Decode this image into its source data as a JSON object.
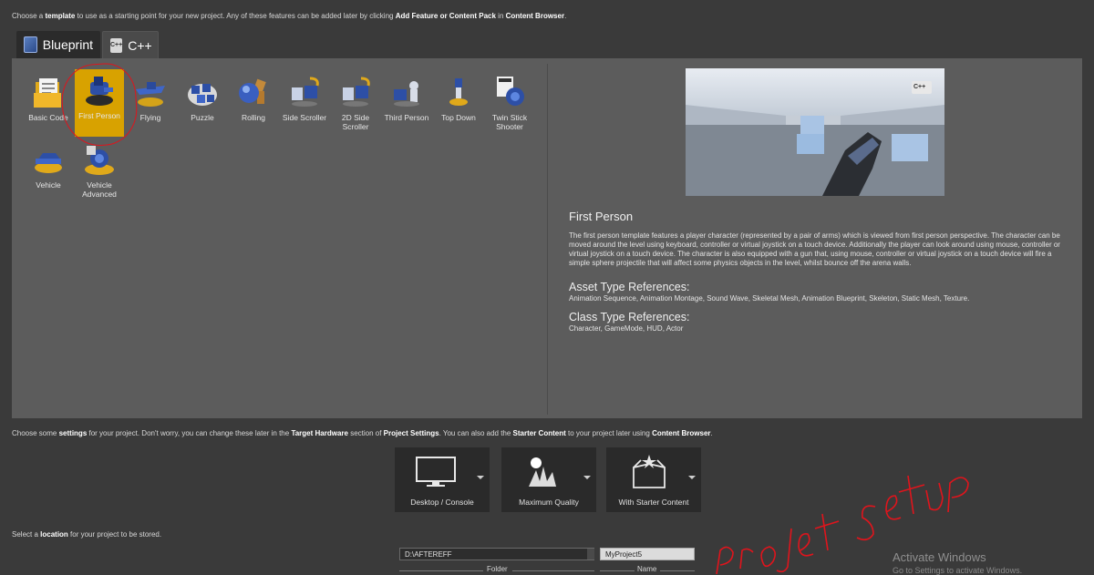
{
  "header": {
    "instr_parts": [
      "Choose a ",
      "template",
      " to use as a starting point for your new project.  Any of these features can be added later by clicking ",
      "Add Feature or Content Pack",
      " in ",
      "Content Browser",
      "."
    ]
  },
  "tabs": [
    {
      "label": "Blueprint",
      "icon": "blueprint-icon"
    },
    {
      "label": "C++",
      "icon": "cpp-icon",
      "icon_text": "C++"
    }
  ],
  "templates": [
    {
      "label": "Basic Code",
      "icon": "basic-code-icon"
    },
    {
      "label": "First Person",
      "icon": "first-person-icon",
      "selected": true
    },
    {
      "label": "Flying",
      "icon": "flying-icon"
    },
    {
      "label": "Puzzle",
      "icon": "puzzle-icon"
    },
    {
      "label": "Rolling",
      "icon": "rolling-icon"
    },
    {
      "label": "Side Scroller",
      "icon": "side-scroller-icon"
    },
    {
      "label": "2D Side Scroller",
      "icon": "2d-side-scroller-icon"
    },
    {
      "label": "Third Person",
      "icon": "third-person-icon"
    },
    {
      "label": "Top Down",
      "icon": "top-down-icon"
    },
    {
      "label": "Twin Stick Shooter",
      "icon": "twin-stick-shooter-icon"
    },
    {
      "label": "Vehicle",
      "icon": "vehicle-icon"
    },
    {
      "label": "Vehicle Advanced",
      "icon": "vehicle-advanced-icon"
    }
  ],
  "preview": {
    "badge": "C++",
    "title": "First Person",
    "description": "The first person template features a player character (represented by a pair of arms) which is viewed from first person perspective. The character can be moved around the level using keyboard, controller or virtual joystick on a touch device. Additionally the player can look around using mouse, controller or virtual joystick on a touch device. The character is also equipped with a gun that, using mouse, controller or virtual joystick on a touch device will fire a simple sphere projectile that will affect some physics objects in the level, whilst bounce off the arena walls.",
    "asset_heading": "Asset Type References:",
    "asset_text": "Animation Sequence, Animation Montage, Sound Wave, Skeletal Mesh, Animation Blueprint, Skeleton, Static Mesh, Texture.",
    "class_heading": "Class Type References:",
    "class_text": "Character, GameMode, HUD, Actor"
  },
  "settings_instr_parts": [
    "Choose some ",
    "settings",
    " for your project.  Don't worry, you can change these later in the ",
    "Target Hardware",
    " section of ",
    "Project Settings",
    ".  You can also add the ",
    "Starter Content",
    " to your project later using ",
    "Content Browser",
    "."
  ],
  "settings": [
    {
      "label": "Desktop / Console",
      "icon": "monitor-icon"
    },
    {
      "label": "Maximum Quality",
      "icon": "quality-icon"
    },
    {
      "label": "With Starter Content",
      "icon": "starter-content-box-icon"
    }
  ],
  "location_instr_parts": [
    "Select a ",
    "location",
    " for your project to be stored."
  ],
  "location": {
    "folder_value": "D:\\AFTEREFF",
    "folder_caption": "Folder",
    "name_value": "MyProject5",
    "name_caption": "Name"
  },
  "annotation": {
    "handwritten": "Projet setup",
    "color": "#e0141c"
  },
  "watermark": {
    "line1": "Activate Windows",
    "line2": "Go to Settings to activate Windows."
  }
}
